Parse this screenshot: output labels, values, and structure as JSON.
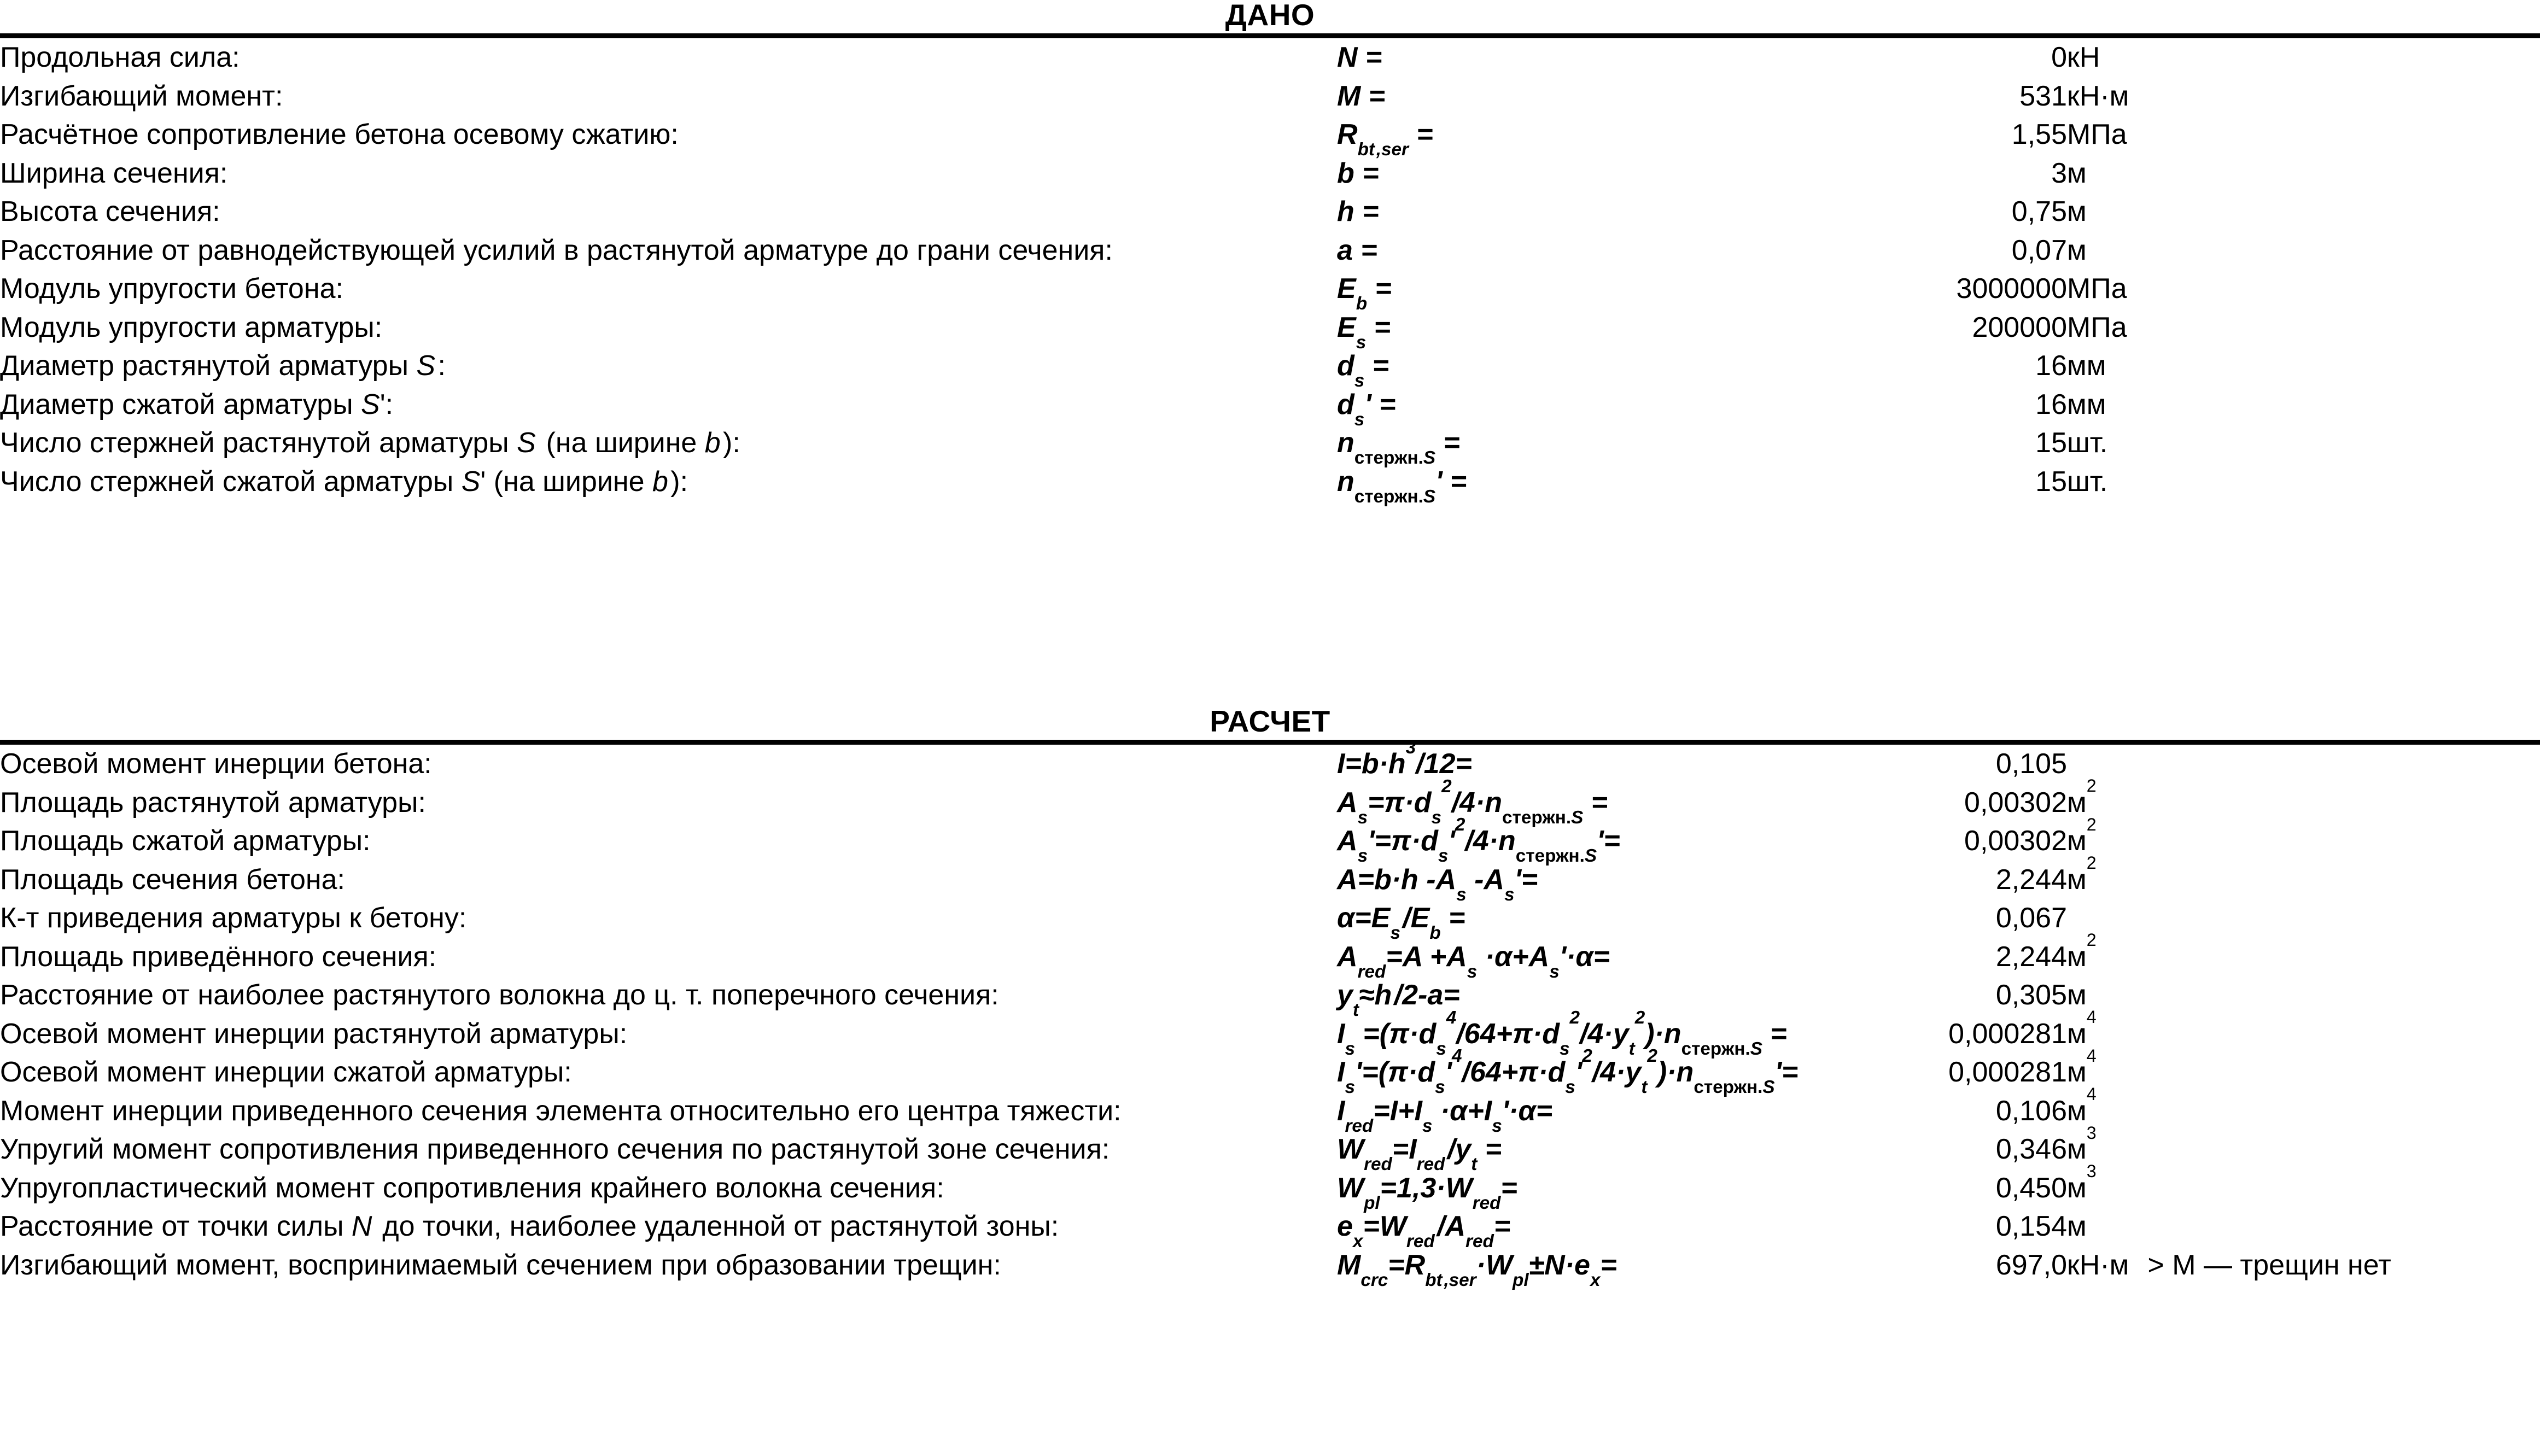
{
  "given": {
    "title": "ДАНО",
    "rows": [
      {
        "label": "Продольная сила:",
        "symbol_html": "<b><i>N</i></b> =",
        "value": "0",
        "unit_html": "кН"
      },
      {
        "label": "Изгибающий момент:",
        "symbol_html": "<b><i>M</i></b> =",
        "value": "531",
        "unit_html": "кН·м"
      },
      {
        "label": "Расчётное сопротивление бетона осевому сжатию:",
        "symbol_html": "<b><i>R</i></b><sub><i>bt</i>&#8202;,<i>ser</i></sub> =",
        "value": "1,55",
        "unit_html": "МПа"
      },
      {
        "label": "Ширина сечения:",
        "symbol_html": "<b><i>b</i></b> =",
        "value": "3",
        "unit_html": "м"
      },
      {
        "label": "Высота сечения:",
        "symbol_html": "<b><i>h</i></b> =",
        "value": "0,75",
        "unit_html": "м"
      },
      {
        "label": "Расстояние от равнодействующей усилий в растянутой арматуре до грани сечения:",
        "symbol_html": "<b><i>a</i></b> =",
        "value": "0,07",
        "unit_html": "м"
      },
      {
        "label": "Модуль упругости бетона:",
        "symbol_html": "<b><i>E</i></b><sub><i>b</i></sub> =",
        "value": "3000000",
        "unit_html": "МПа"
      },
      {
        "label": "Модуль упругости арматуры:",
        "symbol_html": "<b><i>E</i></b><sub><i>s</i></sub> =",
        "value": "200000",
        "unit_html": "МПа"
      },
      {
        "label_html": "Диаметр растянутой арматуры <span class=\"var\">S</span>&#8202;:",
        "symbol_html": "<b><i>d</i></b><sub><i>s</i></sub> =",
        "value": "16",
        "unit_html": "мм"
      },
      {
        "label_html": "Диаметр сжатой арматуры <span class=\"var\">S</span>':",
        "symbol_html": "<b><i>d</i></b><sub><i>s</i></sub>' =",
        "value": "16",
        "unit_html": "мм"
      },
      {
        "label_html": "Число стержней растянутой арматуры <span class=\"var\">S</span>&#8202; (на ширине <span class=\"var\">b</span>&#8202;):",
        "symbol_html": "<b><i>n</i></b><sub><span class=\"up\">стержн.</span><i>S</i></sub> =",
        "value": "15",
        "unit_html": "шт."
      },
      {
        "label_html": "Число стержней сжатой арматуры <span class=\"var\">S</span>' (на ширине <span class=\"var\">b</span>&#8202;):",
        "symbol_html": "<b><i>n</i></b><sub><span class=\"up\">стержн.</span><i>S</i></sub>' =",
        "value": "15",
        "unit_html": "шт."
      }
    ]
  },
  "calc": {
    "title": "РАСЧЕТ",
    "rows": [
      {
        "label": "Осевой момент инерции бетона:",
        "symbol_html": "<b><i>I</i>=<i>b</i>·<i>h</i><sup>3</sup>/12=</b>",
        "value": "0,105",
        "unit_html": ""
      },
      {
        "label": "Площадь растянутой арматуры:",
        "symbol_html": "<b><i>A</i><sub><i>s</i></sub>=π·<i>d</i><sub><i>s</i></sub><sup>2</sup>/4·<i>n</i><sub><span class=\"up\">стержн.</span><i>S</i></sub> =</b>",
        "value": "0,00302",
        "unit_html": "м<sup>2</sup>"
      },
      {
        "label": "Площадь сжатой арматуры:",
        "symbol_html": "<b><i>A</i><sub><i>s</i></sub>'=π·<i>d</i><sub><i>s</i></sub>'<sup>2</sup>/4·<i>n</i><sub><span class=\"up\">стержн.</span><i>S</i></sub>'=</b>",
        "value": "0,00302",
        "unit_html": "м<sup>2</sup>"
      },
      {
        "label": "Площадь сечения бетона:",
        "symbol_html": "<b><i>A</i>=<i>b</i>·<i>h</i> -<i>A</i><sub><i>s</i></sub> -<i>A</i><sub><i>s</i></sub>'=</b>",
        "value": "2,244",
        "unit_html": "м<sup>2</sup>"
      },
      {
        "label": "К-т приведения арматуры к бетону:",
        "symbol_html": "<b>α=<i>E</i><sub><i>s</i></sub>&#8202;/<i>E</i><sub><i>b</i></sub> =</b>",
        "value": "0,067",
        "unit_html": ""
      },
      {
        "label": "Площадь приведённого сечения:",
        "symbol_html": "<b><i>A</i><sub><i>red</i></sub>=<i>A</i> +<i>A</i><sub><i>s</i></sub> ·α+<i>A</i><sub><i>s</i></sub>'·α=</b>",
        "value": "2,244",
        "unit_html": "м<sup>2</sup>"
      },
      {
        "label": "Расстояние от наиболее растянутого волокна до ц. т. поперечного сечения:",
        "symbol_html": "<b><i>y</i><sub><i>t</i></sub>≈<i>h</i>&#8202;/2-<i>a</i>=</b>",
        "value": "0,305",
        "unit_html": "м"
      },
      {
        "label": "Осевой момент инерции растянутой арматуры:",
        "symbol_html": "<b><i>I</i><sub><i>s</i></sub> =(π·<i>d</i><sub><i>s</i></sub><sup>4</sup>/64+π·<i>d</i><sub><i>s</i></sub><sup>2</sup>/4·<i>y</i><sub><i>t</i></sub><sup>2</sup>)·<i>n</i><sub><span class=\"up\">стержн.</span><i>S</i></sub> =</b>",
        "value": "0,000281",
        "unit_html": "м<sup>4</sup>"
      },
      {
        "label": "Осевой момент инерции сжатой арматуры:",
        "symbol_html": "<b><i>I</i><sub><i>s</i></sub>'=(π·<i>d</i><sub><i>s</i></sub>'<sup>4</sup>/64+π·<i>d</i><sub><i>s</i></sub>'<sup>2</sup>/4·<i>y</i><sub><i>t</i></sub><sup>2</sup>)·<i>n</i><sub><span class=\"up\">стержн.</span><i>S</i></sub>'=</b>",
        "value": "0,000281",
        "unit_html": "м<sup>4</sup>"
      },
      {
        "label": "Момент инерции приведенного сечения элемента относительно его центра тяжести:",
        "symbol_html": "<b><i>I</i><sub><i>red</i></sub>=<i>I</i>+<i>I</i><sub><i>s</i></sub> ·α+<i>I</i><sub><i>s</i></sub>'·α=</b>",
        "value": "0,106",
        "unit_html": "м<sup>4</sup>"
      },
      {
        "label": "Упругий момент сопротивления приведенного сечения по растянутой зоне сечения:",
        "symbol_html": "<b><i>W</i><sub><i>red</i></sub>=<i>I</i><sub><i>red</i></sub>&#8202;/<i>y</i><sub><i>t</i></sub> =</b>",
        "value": "0,346",
        "unit_html": "м<sup>3</sup>"
      },
      {
        "label": "Упругопластический момент сопротивления крайнего волокна сечения:",
        "symbol_html": "<b><i>W</i><sub><i>pl</i></sub>=1,3·<i>W</i><sub><i>red</i></sub>=</b>",
        "value": "0,450",
        "unit_html": "м<sup>3</sup>"
      },
      {
        "label_html": "Расстояние от точки силы <span class=\"var\">N</span>&#8202; до точки, наиболее удаленной от растянутой зоны:",
        "symbol_html": "<b><i>e</i><sub><i>x</i></sub>=<i>W</i><sub><i>red</i></sub>&#8202;/<i>A</i><sub><i>red</i></sub>=</b>",
        "value": "0,154",
        "unit_html": "м"
      },
      {
        "label": "Изгибающий момент, воспринимаемый сечением при образовании трещин:",
        "symbol_html": "<b><i>M</i><sub><i>crc</i></sub>=<i>R</i><sub><i>bt</i>&#8202;,<i>ser</i></sub>·<i>W</i><sub><i>pl</i></sub>±<i>N</i>·<i>e</i><sub><i>x</i></sub>=</b>",
        "value": "697,0",
        "unit_html": "кН·м",
        "note": "> M — трещин нет"
      }
    ]
  }
}
